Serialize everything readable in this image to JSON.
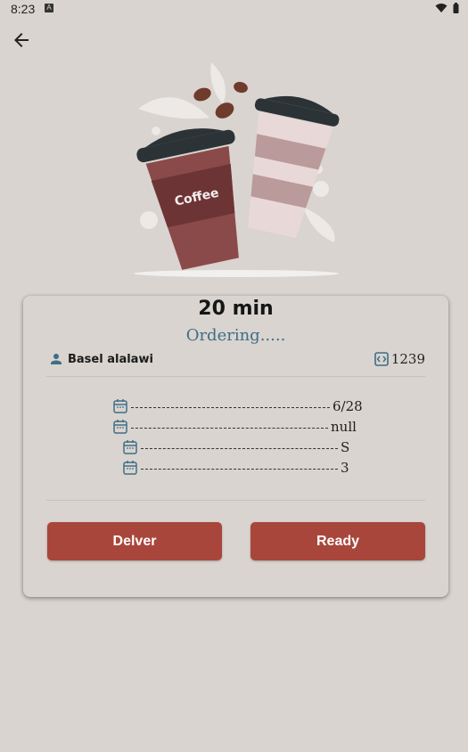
{
  "status_bar": {
    "time": "8:23",
    "notification_badge": "A"
  },
  "header": {
    "back_icon": "arrow-back-icon"
  },
  "hero": {
    "cup_label": "Coffee"
  },
  "order": {
    "duration": "20 min",
    "status": "Ordering.....",
    "customer_name": "Basel alalawi",
    "order_number": "1239",
    "details": [
      {
        "icon": "calendar-icon",
        "value": "6/28"
      },
      {
        "icon": "calendar-icon",
        "value": "null"
      },
      {
        "icon": "calendar-icon",
        "value": "S"
      },
      {
        "icon": "calendar-icon",
        "value": "3"
      }
    ]
  },
  "actions": {
    "deliver_label": "Delver",
    "ready_label": "Ready"
  },
  "colors": {
    "background": "#d9d4cf",
    "accent": "#a9463b",
    "status_text": "#3f6e86",
    "icon": "#3f6e86"
  }
}
